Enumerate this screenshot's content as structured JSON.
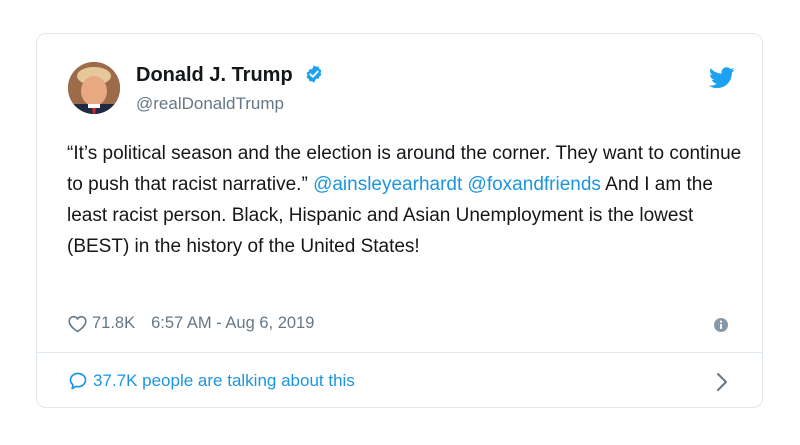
{
  "tweet": {
    "author_name": "Donald J. Trump",
    "author_handle": "@realDonaldTrump",
    "text_part1": "“It’s political season and the election is around the corner. They want to continue to push that racist narrative.”",
    "mention1": "@ainsleyearhardt",
    "mention2": "@foxandfriends",
    "text_part2": "And I am the least racist person. Black, Hispanic and Asian Unemployment is the lowest (BEST) in the history of the United States!",
    "likes": "71.8K",
    "timestamp": "6:57 AM - Aug 6, 2019",
    "talking": "37.7K people are talking about this"
  },
  "icons": {
    "verified": "verified-badge-icon",
    "platform": "twitter-bird-icon",
    "like": "heart-icon",
    "info": "info-icon",
    "reply": "speech-bubble-icon",
    "chevron": "chevron-right-icon"
  },
  "colors": {
    "accent": "#1da1f2",
    "link": "#1b95e0",
    "muted": "#657786",
    "border": "#e1e8ed"
  }
}
